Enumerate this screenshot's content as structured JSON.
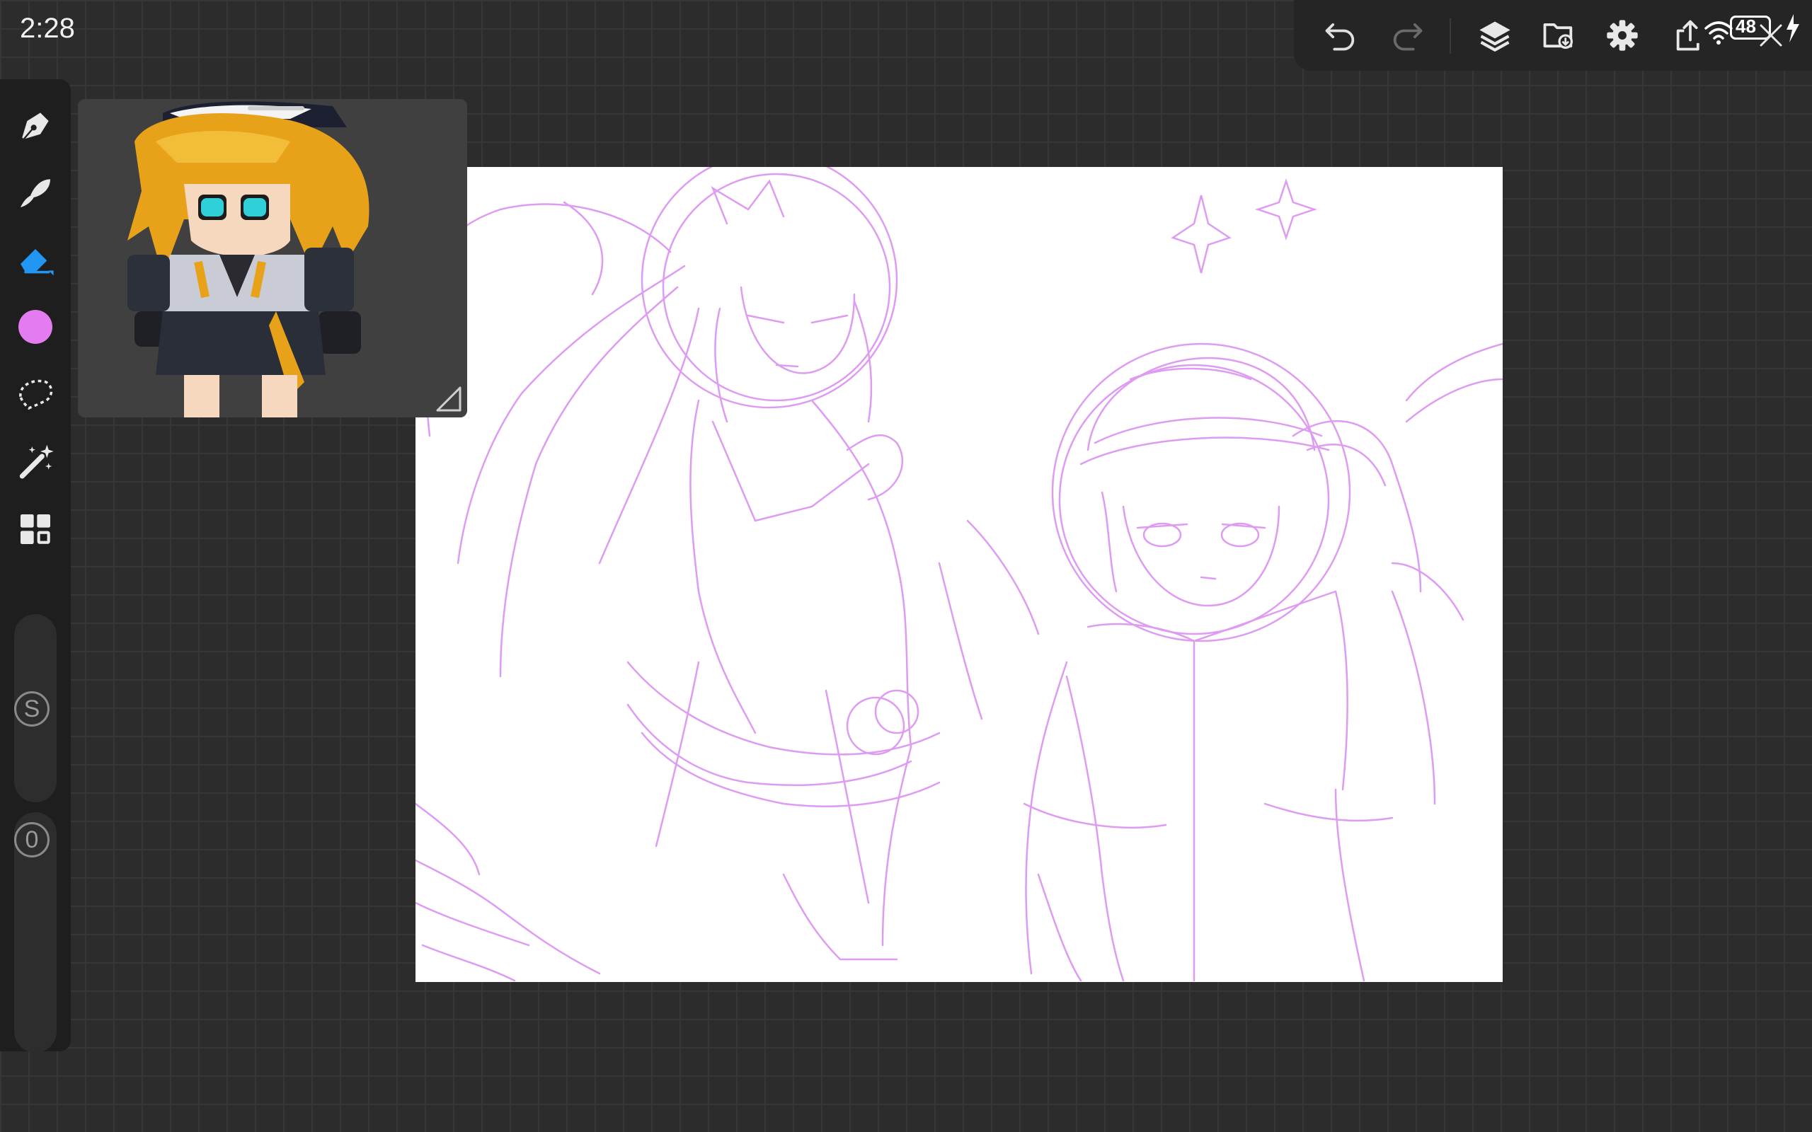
{
  "status_bar": {
    "time": "2:28",
    "battery": "48"
  },
  "top_toolbar": {
    "icons": [
      "undo-icon",
      "redo-icon",
      "layers-icon",
      "import-icon",
      "settings-icon",
      "share-icon"
    ]
  },
  "sidebar": {
    "tools": [
      "pen-icon",
      "blend-icon",
      "eraser-icon",
      "color-icon",
      "lasso-icon",
      "magic-wand-icon",
      "apps-icon"
    ],
    "active_tool": "eraser",
    "active_color": "#e27cf0",
    "size_slider_label": "S",
    "opacity_slider_label": "0"
  },
  "reference_window": {
    "description_icon": "reference-image"
  },
  "canvas": {
    "stroke_color": "#d98af0"
  }
}
